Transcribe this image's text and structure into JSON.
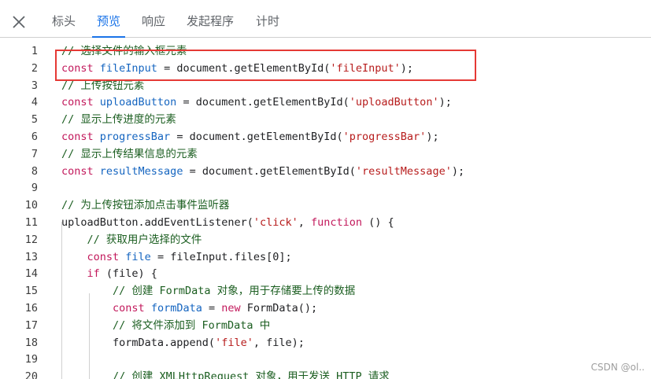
{
  "toolbar": {
    "close_icon": "close-icon",
    "tabs": [
      {
        "label": "标头",
        "active": false
      },
      {
        "label": "预览",
        "active": true
      },
      {
        "label": "响应",
        "active": false
      },
      {
        "label": "发起程序",
        "active": false
      },
      {
        "label": "计时",
        "active": false
      }
    ]
  },
  "code_lines": [
    {
      "n": "1",
      "text": "// 选择文件的输入框元素"
    },
    {
      "n": "2",
      "text": "const fileInput = document.getElementById('fileInput');"
    },
    {
      "n": "3",
      "text": "// 上传按钮元素"
    },
    {
      "n": "4",
      "text": "const uploadButton = document.getElementById('uploadButton');"
    },
    {
      "n": "5",
      "text": "// 显示上传进度的元素"
    },
    {
      "n": "6",
      "text": "const progressBar = document.getElementById('progressBar');"
    },
    {
      "n": "7",
      "text": "// 显示上传结果信息的元素"
    },
    {
      "n": "8",
      "text": "const resultMessage = document.getElementById('resultMessage');"
    },
    {
      "n": "9",
      "text": ""
    },
    {
      "n": "10",
      "text": "// 为上传按钮添加点击事件监听器"
    },
    {
      "n": "11",
      "text": "uploadButton.addEventListener('click', function () {"
    },
    {
      "n": "12",
      "text": "    // 获取用户选择的文件"
    },
    {
      "n": "13",
      "text": "    const file = fileInput.files[0];"
    },
    {
      "n": "14",
      "text": "    if (file) {"
    },
    {
      "n": "15",
      "text": "        // 创建 FormData 对象，用于存储要上传的数据"
    },
    {
      "n": "16",
      "text": "        const formData = new FormData();"
    },
    {
      "n": "17",
      "text": "        // 将文件添加到 FormData 中"
    },
    {
      "n": "18",
      "text": "        formData.append('file', file);"
    },
    {
      "n": "19",
      "text": ""
    },
    {
      "n": "20",
      "text": "        // 创建 XMLHttpRequest 对象，用于发送 HTTP 请求"
    }
  ],
  "watermark": "CSDN @ol.."
}
